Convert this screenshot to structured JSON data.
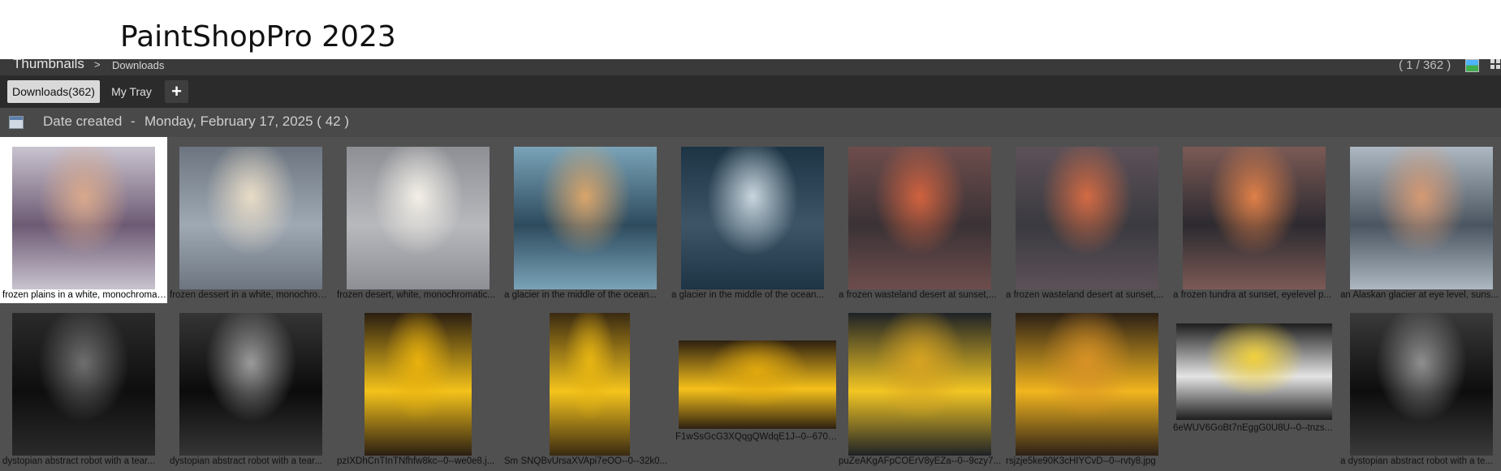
{
  "app": {
    "title": "PaintShopPro 2023"
  },
  "breadcrumb": {
    "root": "Thumbnails",
    "separator": ">",
    "current": "Downloads",
    "page_count": "( 1 / 362 )"
  },
  "tabs": [
    {
      "label": "Downloads(362)",
      "active": true
    },
    {
      "label": "My Tray",
      "active": false
    },
    {
      "label": "+",
      "active": false
    }
  ],
  "group": {
    "label": "Date created",
    "separator": "-",
    "value": "Monday, February 17, 2025 ( 42 )"
  },
  "thumbnails": [
    {
      "caption": "frozen plains in a white, monochromatic...",
      "selected": true,
      "colors": [
        "#6d5a74",
        "#d9a98c",
        "#c9c3cf"
      ]
    },
    {
      "caption": "frozen dessert in a white, monochromatic...",
      "selected": false,
      "colors": [
        "#9fa9b4",
        "#e9dcc7",
        "#6c7580"
      ]
    },
    {
      "caption": "frozen desert, white, monochromatic...",
      "selected": false,
      "colors": [
        "#b8b9bd",
        "#f3efe7",
        "#8d8f95"
      ]
    },
    {
      "caption": "a glacier in the middle of the ocean...",
      "selected": false,
      "colors": [
        "#2e4b5e",
        "#d9a56a",
        "#7aa3b8"
      ]
    },
    {
      "caption": "a glacier in the middle of the ocean...",
      "selected": false,
      "colors": [
        "#3d5567",
        "#c9d6df",
        "#1c3444"
      ]
    },
    {
      "caption": "a frozen wasteland desert at sunset,...",
      "selected": false,
      "colors": [
        "#3a3236",
        "#d0623f",
        "#6e4d4c"
      ]
    },
    {
      "caption": "a frozen wasteland desert at sunset,...",
      "selected": false,
      "colors": [
        "#3a3a40",
        "#d36a43",
        "#5d5158"
      ]
    },
    {
      "caption": "a frozen tundra at sunset, eyelevel p...",
      "selected": false,
      "colors": [
        "#2c2a30",
        "#e08048",
        "#7b5a55"
      ]
    },
    {
      "caption": "an Alaskan glacier at eye level, suns...",
      "selected": false,
      "colors": [
        "#4a5561",
        "#d59a74",
        "#aeb8c2"
      ]
    },
    {
      "caption": "dystopian abstract robot with a tear...",
      "selected": false,
      "colors": [
        "#0e0e0e",
        "#6f6f6f",
        "#2a2a2a"
      ]
    },
    {
      "caption": "dystopian abstract robot with a tear...",
      "selected": false,
      "colors": [
        "#0b0b0b",
        "#9b9b9b",
        "#353535"
      ]
    },
    {
      "caption": "pzIXDhCnTInTNfhfw8kc--0--we0e8.j...",
      "selected": false,
      "colors": [
        "#f4c21a",
        "#e8b10d",
        "#2a1e12"
      ]
    },
    {
      "caption": "Sm SNQBvUrsaXVApi7eOO--0--32k0...",
      "selected": false,
      "colors": [
        "#f5c41c",
        "#e7b512",
        "#3a2a12"
      ]
    },
    {
      "caption": "F1wSsGcG3XQqgQWdqE1J--0--6708...",
      "selected": false,
      "colors": [
        "#f6c11b",
        "#e0a80e",
        "#2e2010"
      ]
    },
    {
      "caption": "puZeAKgAFpCOErV8yEZa--0--9czy7...",
      "selected": false,
      "colors": [
        "#f3c623",
        "#d6a322",
        "#1e2226"
      ]
    },
    {
      "caption": "rsjzje5ke90K3cHIYCvD--0--rvty8.jpg",
      "selected": false,
      "colors": [
        "#f2b51f",
        "#d89226",
        "#2c2016"
      ]
    },
    {
      "caption": "6eWUV6GoBt7nEggG0U8U--0--tnzs...",
      "selected": false,
      "colors": [
        "#e4e4e4",
        "#f2d13c",
        "#1e1e1e"
      ]
    },
    {
      "caption": "a dystopian abstract robot with a te...",
      "selected": false,
      "colors": [
        "#0d0d0d",
        "#8f8f8f",
        "#3a3a3a"
      ]
    }
  ]
}
